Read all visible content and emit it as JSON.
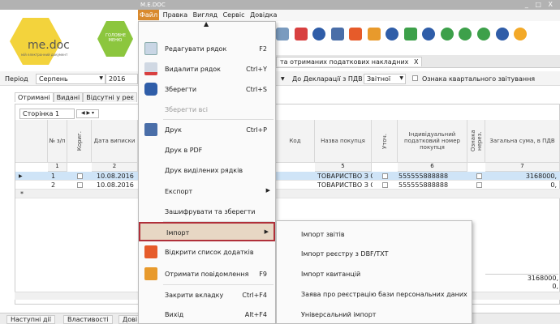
{
  "window": {
    "title": "M.E.DOC",
    "controls": "_ □ X"
  },
  "menubar": {
    "items": [
      "Файл",
      "Правка",
      "Вигляд",
      "Сервіс",
      "Довідка"
    ]
  },
  "logo": {
    "text": "me.doc",
    "subtitle": "мій електронний документ",
    "badge": "ГОЛОВНЕ МЕНЮ"
  },
  "doc_tab": {
    "label": "та отриманих податкових накладних",
    "close": "X"
  },
  "filter": {
    "period_label": "Період",
    "month": "Серпень",
    "year": "2016",
    "declaration_label": "До Декларації з ПДВ",
    "declaration_value": "Звітної",
    "quarterly_label": "Ознака квартального звітування"
  },
  "subtabs": [
    "Отримані",
    "Видані",
    "Відсутні у реє"
  ],
  "page_combo": "Сторінка 1",
  "pager": "◀ ▶ ▾",
  "table": {
    "headers": [
      "№ з/п",
      "Кориг.",
      "Дата виписки",
      "Код",
      "Назва покупця",
      "Уточ.",
      "Індивідуальний податковий номер покупця",
      "Ознака нерез.",
      "Загальна сума, в ПДВ"
    ],
    "numbers": [
      "1",
      "2",
      "5",
      "6",
      "7"
    ],
    "rows": [
      {
        "n": "1",
        "date": "10.08.2016",
        "name": "ТОВАРИСТВО З О",
        "ipn": "555555888888",
        "sum": "3168000,"
      },
      {
        "n": "2",
        "date": "10.08.2016",
        "name": "ТОВАРИСТВО З О",
        "ipn": "555555888888",
        "sum": "0,"
      }
    ],
    "totals": [
      "3168000,",
      "0,"
    ]
  },
  "file_menu": {
    "items": [
      {
        "label": "Редагувати рядок",
        "shortcut": "F2",
        "icon": "edit-icon"
      },
      {
        "label": "Видалити рядок",
        "shortcut": "Ctrl+Y",
        "icon": "delete-icon"
      },
      {
        "label": "Зберегти",
        "shortcut": "Ctrl+S",
        "icon": "save-icon"
      },
      {
        "label": "Зберегти всі",
        "shortcut": "",
        "icon": ""
      },
      {
        "label": "Друк",
        "shortcut": "Ctrl+P",
        "icon": "print-icon"
      },
      {
        "label": "Друк в PDF",
        "shortcut": "",
        "icon": ""
      },
      {
        "label": "Друк виділених рядків",
        "shortcut": "",
        "icon": ""
      },
      {
        "label": "Експорт",
        "shortcut": "",
        "icon": ""
      },
      {
        "label": "Зашифрувати та зберегти",
        "shortcut": "",
        "icon": ""
      },
      {
        "label": "Імпорт",
        "shortcut": "",
        "icon": ""
      },
      {
        "label": "Відкрити список додатків",
        "shortcut": "",
        "icon": "list-icon"
      },
      {
        "label": "Отримати повідомлення",
        "shortcut": "F9",
        "icon": "receive-icon"
      },
      {
        "label": "Закрити вкладку",
        "shortcut": "Ctrl+F4",
        "icon": ""
      },
      {
        "label": "Вихід",
        "shortcut": "Alt+F4",
        "icon": ""
      }
    ]
  },
  "import_submenu": {
    "items": [
      "Імпорт звітів",
      "Імпорт реєстру з DBF/TXT",
      "Імпорт квитанцій",
      "Заява про реєстрацію бази персональних даних",
      "Універсальний імпорт"
    ]
  },
  "bottom_tabs": [
    "Наступні дії",
    "Властивості",
    "Дові"
  ],
  "colors": {
    "accent": "#d98a2e",
    "selection": "#cfe4f7",
    "highlight_border": "#b0303a"
  }
}
